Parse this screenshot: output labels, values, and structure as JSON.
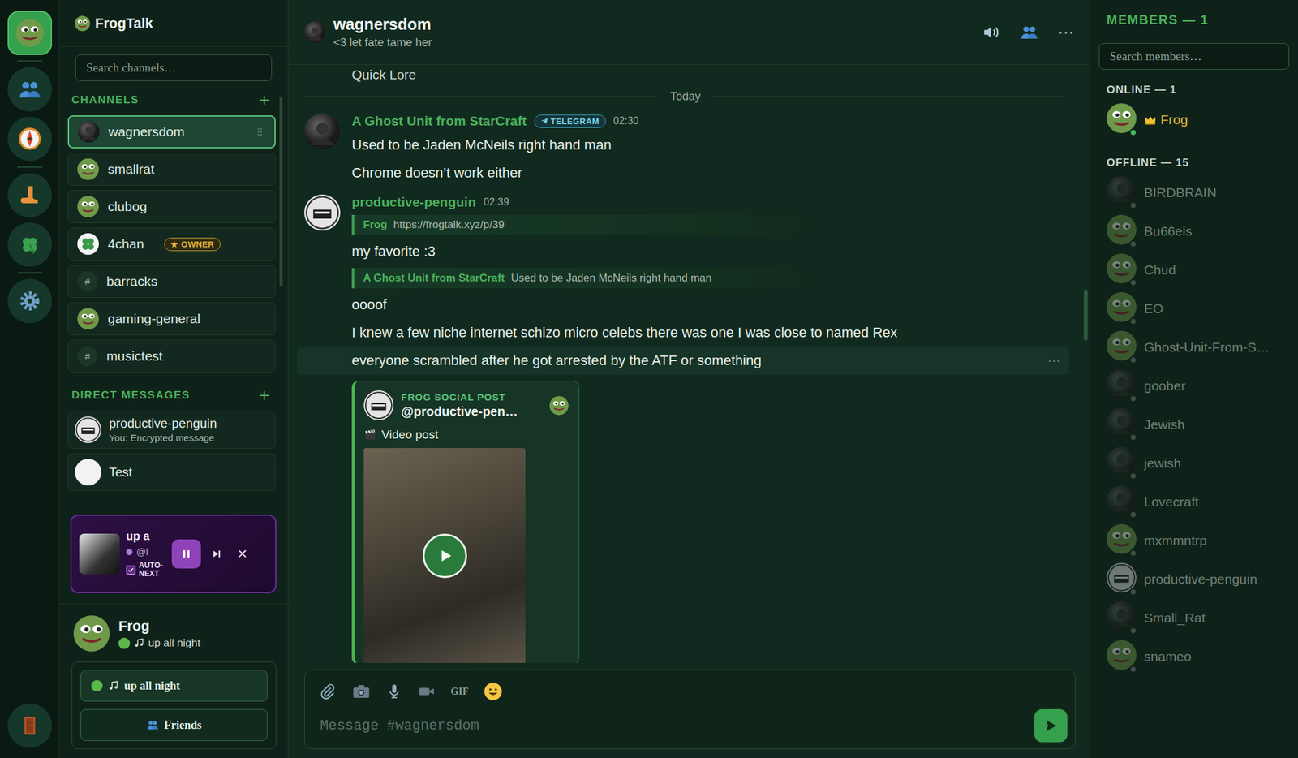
{
  "app": {
    "title": "FrogTalk"
  },
  "rail": {
    "items": [
      {
        "kind": "frog",
        "selected": true
      },
      {
        "kind": "friends",
        "selected": false
      },
      {
        "kind": "compass",
        "selected": false
      },
      {
        "kind": "boot",
        "selected": false
      },
      {
        "kind": "clover",
        "selected": false
      },
      {
        "kind": "settings",
        "selected": false
      }
    ]
  },
  "channel_search": {
    "placeholder": "Search channels…"
  },
  "channels": {
    "heading": "CHANNELS",
    "add": "+",
    "items": [
      {
        "name": "wagnersdom",
        "kind": "photo",
        "selected": true
      },
      {
        "name": "smallrat",
        "kind": "frog",
        "selected": false
      },
      {
        "name": "clubog",
        "kind": "frog",
        "selected": false
      },
      {
        "name": "4chan",
        "kind": "clover",
        "selected": false,
        "badge": "★ OWNER"
      },
      {
        "name": "barracks",
        "kind": "hash",
        "icon": "#",
        "selected": false
      },
      {
        "name": "gaming-general",
        "kind": "frog",
        "selected": false
      },
      {
        "name": "musictest",
        "kind": "hash",
        "icon": "#",
        "selected": false
      }
    ]
  },
  "dms": {
    "heading": "DIRECT MESSAGES",
    "add": "+",
    "items": [
      {
        "name": "productive-penguin",
        "preview": "You: Encrypted message",
        "kind": "penguin"
      },
      {
        "name": "Test",
        "kind": "blank"
      }
    ]
  },
  "player": {
    "title": "up a",
    "artist": "@l",
    "playing": true,
    "autonext": {
      "label": "AUTO-NEXT",
      "checked": true
    },
    "close": "✕"
  },
  "user": {
    "name": "Frog",
    "status": "up all night",
    "online": true
  },
  "status_box": {
    "status": "up all night",
    "online": true,
    "friends": "Friends"
  },
  "chat": {
    "title": "wagnersdom",
    "topic": "<3 let fate tame her",
    "menu": "⋯",
    "composer": {
      "placeholder": "Message #wagnersdom",
      "gif": "GIF"
    }
  },
  "messages": {
    "above": "Quick Lore",
    "divider": "Today",
    "groups": [
      {
        "author": "A Ghost Unit from StarCraft",
        "badge": "TELEGRAM",
        "time": "02:30",
        "avatar": "photo",
        "lines": [
          {
            "kind": "text",
            "text": "Used to be Jaden McNeils right hand man",
            "hovered": false
          },
          {
            "kind": "text",
            "text": "Chrome doesn’t work either",
            "hovered": false
          }
        ]
      },
      {
        "author": "productive-penguin",
        "time": "02:39",
        "avatar": "penguin",
        "lines": [
          {
            "kind": "reply",
            "author": "Frog",
            "text": "https://frogtalk.xyz/p/39"
          },
          {
            "kind": "text",
            "text": "my favorite :3",
            "hovered": false
          },
          {
            "kind": "reply",
            "author": "A Ghost Unit from StarCraft",
            "text": "Used to be Jaden McNeils right hand man"
          },
          {
            "kind": "text",
            "text": "oooof",
            "hovered": false
          },
          {
            "kind": "text",
            "text": "I knew a few niche internet schizo micro celebs there was one I was close to named Rex",
            "hovered": false
          },
          {
            "kind": "text",
            "text": "everyone scrambled after he got arrested by the ATF or something",
            "hovered": true,
            "menu": "⋯"
          },
          {
            "kind": "embed",
            "label": "FROG SOCIAL POST",
            "handle": "@productive-pen…",
            "caption": "Video post"
          }
        ]
      }
    ]
  },
  "members": {
    "heading": "MEMBERS — 1",
    "search_placeholder": "Search members…",
    "sections": [
      {
        "heading": "ONLINE — 1",
        "items": [
          {
            "name": "Frog",
            "online": true,
            "crown": true,
            "kind": "frog"
          }
        ]
      },
      {
        "heading": "OFFLINE — 15",
        "items": [
          {
            "name": "BIRDBRAIN",
            "online": false,
            "crown": false,
            "kind": "photo"
          },
          {
            "name": "Bu66els",
            "online": false,
            "crown": false,
            "kind": "frog"
          },
          {
            "name": "Chud",
            "online": false,
            "crown": false,
            "kind": "frog"
          },
          {
            "name": "EO",
            "online": false,
            "crown": false,
            "kind": "frog"
          },
          {
            "name": "Ghost-Unit-From-S…",
            "online": false,
            "crown": false,
            "kind": "frog"
          },
          {
            "name": "goober",
            "online": false,
            "crown": false,
            "kind": "photo"
          },
          {
            "name": "Jewish",
            "online": false,
            "crown": false,
            "kind": "photo"
          },
          {
            "name": "jewish",
            "online": false,
            "crown": false,
            "kind": "photo"
          },
          {
            "name": "Lovecraft",
            "online": false,
            "crown": false,
            "kind": "photo"
          },
          {
            "name": "mxmmntrp",
            "online": false,
            "crown": false,
            "kind": "frog"
          },
          {
            "name": "productive-penguin",
            "online": false,
            "crown": false,
            "kind": "penguin"
          },
          {
            "name": "Small_Rat",
            "online": false,
            "crown": false,
            "kind": "photo"
          },
          {
            "name": "snameo",
            "online": false,
            "crown": false,
            "kind": "frog"
          }
        ]
      }
    ]
  }
}
